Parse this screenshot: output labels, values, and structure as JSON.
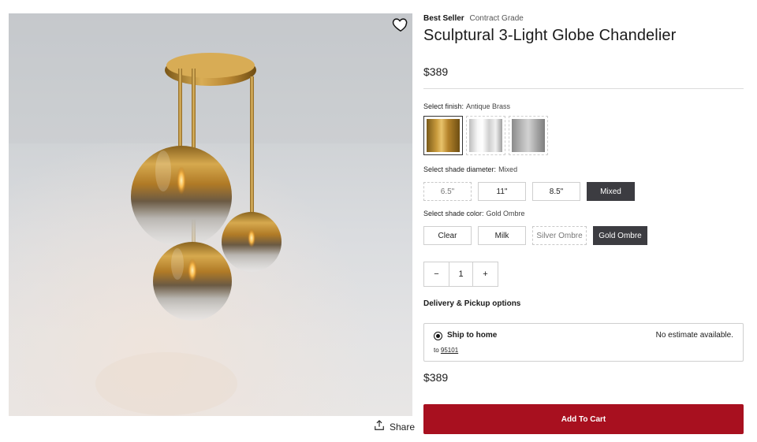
{
  "product": {
    "badges": {
      "best_seller": "Best Seller",
      "contract_grade": "Contract Grade"
    },
    "title": "Sculptural 3-Light Globe Chandelier",
    "price": "$389"
  },
  "finish": {
    "label": "Select finish:",
    "selected": "Antique Brass",
    "swatches": [
      {
        "name": "Antique Brass",
        "selected": true
      },
      {
        "name": "Polished Nickel",
        "selected": false
      },
      {
        "name": "Brushed Nickel",
        "selected": false
      }
    ]
  },
  "shade_diameter": {
    "label": "Select shade diameter:",
    "selected": "Mixed",
    "options": [
      "6.5\"",
      "11\"",
      "8.5\"",
      "Mixed"
    ]
  },
  "shade_color": {
    "label": "Select shade color:",
    "selected": "Gold Ombre",
    "options": [
      "Clear",
      "Milk",
      "Silver Ombre",
      "Gold Ombre"
    ]
  },
  "quantity": {
    "minus": "−",
    "value": "1",
    "plus": "+"
  },
  "delivery": {
    "title": "Delivery & Pickup options",
    "ship_label": "Ship to home",
    "to_prefix": "to",
    "zip": "95101",
    "estimate": "No estimate available."
  },
  "actions": {
    "share_label": "Share",
    "add_to_cart": "Add To Cart"
  },
  "icons": {
    "favorite": "heart-icon",
    "share": "share-icon"
  },
  "colors": {
    "cart_button": "#a8101f",
    "selected_option": "#3c3c41",
    "brass": "#c89a3c"
  }
}
